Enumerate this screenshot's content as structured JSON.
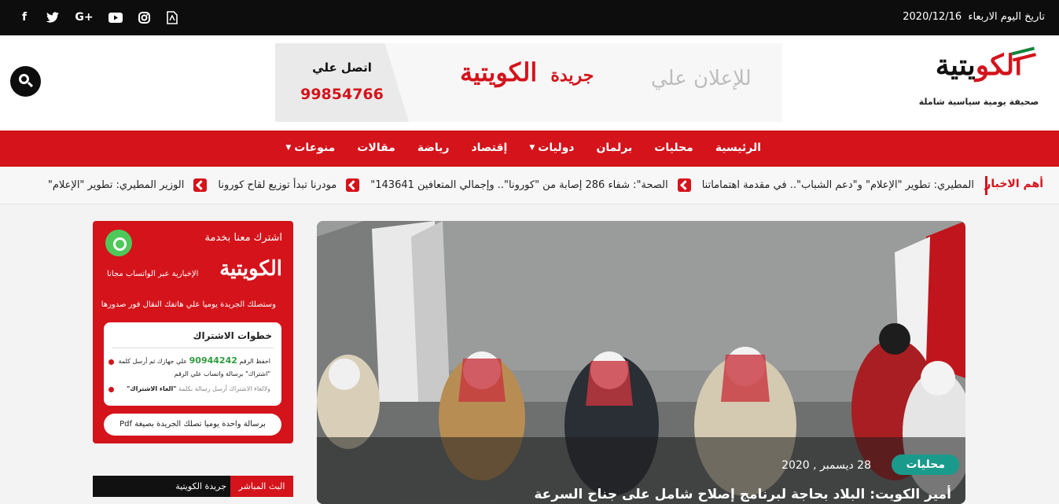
{
  "topbar": {
    "date_prefix": "تاريخ اليوم الاربعاء",
    "date_value": "2020/12/16",
    "socials": [
      "facebook-icon",
      "twitter-icon",
      "google-plus-icon",
      "youtube-icon",
      "instagram-icon",
      "pdf-icon"
    ]
  },
  "header": {
    "logo_text_red": "الكو",
    "logo_text_black": "يتية",
    "slogan": "صحيفة يومية سياسية شاملة",
    "ad": {
      "for_ads": "للإعلان علي",
      "paper_prefix": "جريدة",
      "paper_name": "الكويتية",
      "call_label": "اتصل علي",
      "call_number": "99854766"
    }
  },
  "nav": {
    "items": [
      {
        "label": "الرئيسية",
        "has_dropdown": false
      },
      {
        "label": "محليات",
        "has_dropdown": false
      },
      {
        "label": "برلمان",
        "has_dropdown": false
      },
      {
        "label": "دوليات",
        "has_dropdown": true
      },
      {
        "label": "إقتصاد",
        "has_dropdown": false
      },
      {
        "label": "رياضة",
        "has_dropdown": false
      },
      {
        "label": "مقالات",
        "has_dropdown": false
      },
      {
        "label": "منوعات",
        "has_dropdown": true
      }
    ]
  },
  "ticker": {
    "label": "أهم الاخبار",
    "items": [
      "المطيري: تطوير \"الإعلام\" و\"دعم الشباب\".. في مقدمة اهتماماتنا",
      "الصحة\": شفاء 286 إصابة من \"كورونا\".. وإجمالي المتعافين 143641\"",
      "مودرنا تبدأ توزيع لقاح كورونا",
      "الوزير المطيري: تطوير \"الإعلام\""
    ]
  },
  "hero": {
    "category": "محليات",
    "date": "28 ديسمبر , 2020",
    "headline": "أمير الكويت: البلاد بحاجة لبرنامج إصلاح شامل على جناح السرعة"
  },
  "promo": {
    "subscribe_line": "اشترك معنا بخدمة",
    "brand": "الكويتية",
    "whatsapp_line": "الإخبارية عبر الواتساب مجانا",
    "receive_line": "وستصلك الجريدة يوميا علي هاتفك النقال فور صدورها",
    "steps_title": "خطوات الاشتراك",
    "step1_a": "احفظ الرقم",
    "step1_number": "90944242",
    "step1_b": "علي جهازك ثم أرسل كلمة \"اشتراك\" برسالة واتساب علي الرقم",
    "step2_a": "ولالغاء الاشتراك أرسل رسالة بكلمة",
    "step2_word": "\"الغاء الاشتراك\"",
    "pdf_line": "برسالة واحدة يوميا تصلك الجريدة بصيغة Pdf"
  },
  "live": {
    "tab_active": "البث المباشر",
    "tab_other": "جريدة الكويتية"
  },
  "colors": {
    "brand_red": "#d4131b",
    "category_teal": "#1a9a8b",
    "whatsapp_green": "#4fc85a"
  }
}
